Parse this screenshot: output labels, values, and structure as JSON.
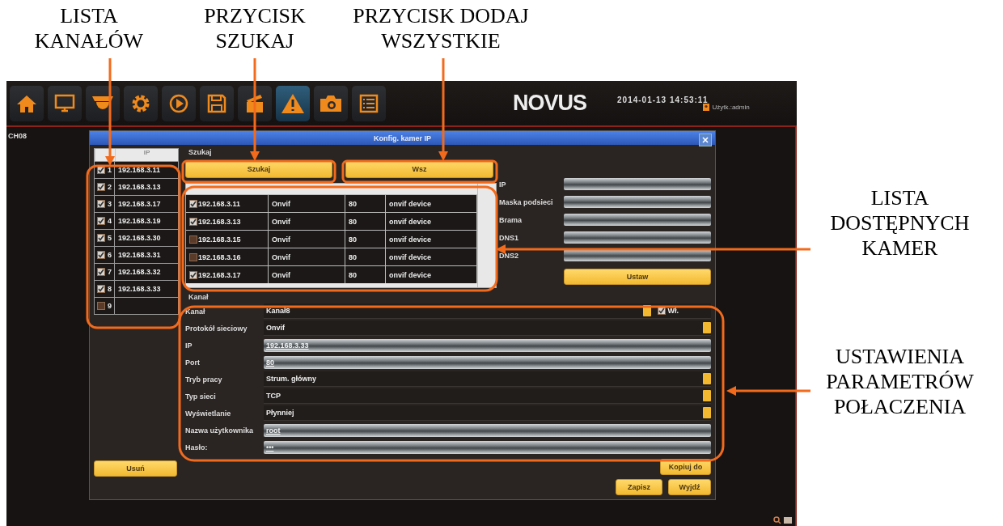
{
  "annotations": {
    "top": [
      {
        "lines": [
          "LISTA",
          "KANAŁÓW"
        ]
      },
      {
        "lines": [
          "PRZYCISK",
          "SZUKAJ"
        ]
      },
      {
        "lines": [
          "PRZYCISK DODAJ",
          "WSZYSTKIE"
        ]
      }
    ],
    "right": [
      {
        "lines": [
          "LISTA",
          "DOSTĘPNYCH",
          "KAMER"
        ]
      },
      {
        "lines": [
          "USTAWIENIA",
          "PARAMETRÓW",
          "POŁACZENIA"
        ]
      }
    ]
  },
  "toolbar": [
    {
      "selected": false
    },
    {
      "selected": false
    },
    {
      "selected": false
    },
    {
      "selected": false
    },
    {
      "selected": false
    },
    {
      "selected": false
    },
    {
      "selected": false
    },
    {
      "selected": true
    },
    {
      "selected": false
    },
    {
      "selected": false
    }
  ],
  "logo": "NOVUS",
  "datetime": "2014-01-13  14:53:11",
  "user": "Użytk.:admin",
  "channel_label": "CH08",
  "dialog": {
    "title": "Konfig. kamer IP",
    "channel_list": {
      "header": "IP",
      "channels": [
        {
          "number": "1",
          "ip": "192.168.3.11",
          "checked": true
        },
        {
          "number": "2",
          "ip": "192.168.3.13",
          "checked": true
        },
        {
          "number": "3",
          "ip": "192.168.3.17",
          "checked": true
        },
        {
          "number": "4",
          "ip": "192.168.3.19",
          "checked": true
        },
        {
          "number": "5",
          "ip": "192.168.3.30",
          "checked": true
        },
        {
          "number": "6",
          "ip": "192.168.3.31",
          "checked": true
        },
        {
          "number": "7",
          "ip": "192.168.3.32",
          "checked": true
        },
        {
          "number": "8",
          "ip": "192.168.3.33",
          "checked": true
        },
        {
          "number": "9",
          "checked": false
        }
      ]
    },
    "delete_button": "Usuń",
    "search_label": "Szukaj",
    "search_button": "Szukaj",
    "add_all_button": "Wsz",
    "found_cameras": [
      {
        "checked": true,
        "column_1": "192.168.3.11",
        "column_2": "Onvif",
        "column_3": "80",
        "column_4": "onvif device"
      },
      {
        "checked": true,
        "column_1": "192.168.3.13",
        "column_2": "Onvif",
        "column_3": "80",
        "column_4": "onvif device"
      },
      {
        "checked": false,
        "column_1": "192.168.3.15",
        "column_2": "Onvif",
        "column_3": "80",
        "column_4": "onvif device"
      },
      {
        "checked": false,
        "column_1": "192.168.3.16",
        "column_2": "Onvif",
        "column_3": "80",
        "column_4": "onvif device"
      },
      {
        "checked": true,
        "column_1": "192.168.3.17",
        "column_2": "Onvif",
        "column_3": "80",
        "column_4": "onvif device"
      }
    ],
    "network_fields": [
      "IP",
      "Maska podsieci",
      "Brama",
      "DNS1",
      "DNS2"
    ],
    "set_button": "Ustaw",
    "channel_section": {
      "title": "Kanał",
      "rows": [
        {
          "kind": "channel",
          "label": "Kanał",
          "value": "Kanał8",
          "enabled": true,
          "enabled_label": "Wł."
        },
        {
          "kind": "select",
          "label": "Protokół sieciowy",
          "value": "Onvif"
        },
        {
          "kind": "input",
          "label": "IP",
          "value": "192.168.3.33"
        },
        {
          "kind": "input",
          "label": "Port",
          "value": "80"
        },
        {
          "kind": "select",
          "label": "Tryb pracy",
          "value": "Strum. główny"
        },
        {
          "kind": "select",
          "label": "Typ sieci",
          "value": "TCP"
        },
        {
          "kind": "select",
          "label": "Wyświetlanie",
          "value": "Płynniej"
        },
        {
          "kind": "input",
          "label": "Nazwa użytkownika",
          "value": "root"
        },
        {
          "kind": "input",
          "label": "Hasło:",
          "value": "•••"
        }
      ]
    },
    "copy_button": "Kopiuj do",
    "save_button": "Zapisz",
    "exit_button": "Wyjdź"
  }
}
